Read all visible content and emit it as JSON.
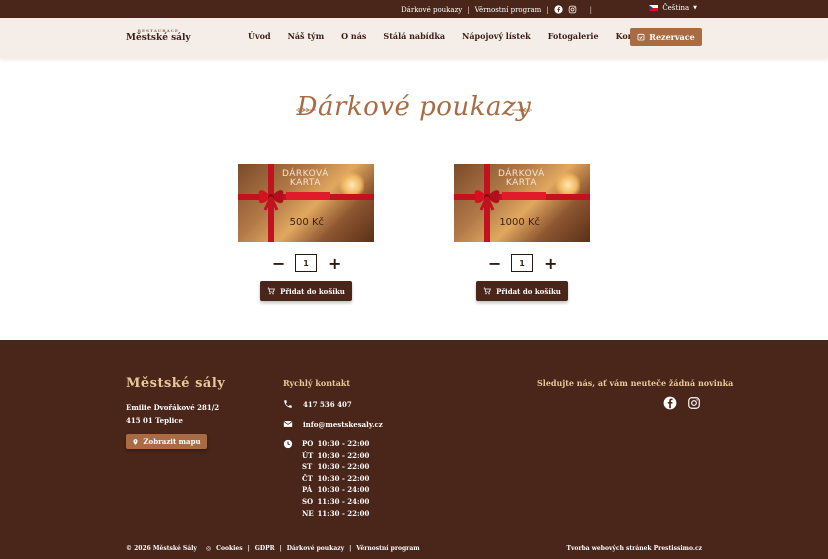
{
  "topbar": {
    "links": [
      "Dárkové poukazy",
      "Věrnostní program"
    ],
    "language": "Čeština"
  },
  "header": {
    "logo_small": "RESTAURACE",
    "logo_main": "Městské sály",
    "nav": [
      "Úvod",
      "Náš tým",
      "O nás",
      "Stálá nabídka",
      "Nápojový lístek",
      "Fotogalerie",
      "Kontakty"
    ],
    "reserve_label": "Rezervace"
  },
  "main": {
    "title": "Dárkové poukazy",
    "products": [
      {
        "card_label_line1": "DÁRKOVÁ",
        "card_label_line2": "KARTA",
        "price": "500 Kč",
        "quantity": "1",
        "add_label": "Přidat do košíku"
      },
      {
        "card_label_line1": "DÁRKOVÁ",
        "card_label_line2": "KARTA",
        "price": "1000 Kč",
        "quantity": "1",
        "add_label": "Přidat do košíku"
      }
    ]
  },
  "footer": {
    "logo": "Městské sály",
    "address_line1": "Emilie Dvořákové 281/2",
    "address_line2": "415 01 Teplice",
    "map_button": "Zobrazit mapu",
    "contact_title": "Rychlý kontakt",
    "phone": "417 536 407",
    "email": "info@mestskesaly.cz",
    "hours": [
      {
        "day": "PO",
        "time": "10:30 - 22:00"
      },
      {
        "day": "ÚT",
        "time": "10:30 - 22:00"
      },
      {
        "day": "ST",
        "time": "10:30 - 22:00"
      },
      {
        "day": "ČT",
        "time": "10:30 - 22:00"
      },
      {
        "day": "PÁ",
        "time": "10:30 - 24:00"
      },
      {
        "day": "SO",
        "time": "11:30 - 24:00"
      },
      {
        "day": "NE",
        "time": "11:30 - 22:00"
      }
    ],
    "follow_title": "Sledujte nás, ať vám neuteče žádná novinka",
    "copyright": "© 2026 Městské Sály",
    "bottom_links": [
      "Cookies",
      "GDPR",
      "Dárkové poukazy",
      "Věrnostní program"
    ],
    "credit": "Tvorba webových stránek Prestissimo.cz"
  },
  "colors": {
    "brown_dark": "#4a2519",
    "accent": "#a86b43",
    "gold": "#e9c79a"
  }
}
